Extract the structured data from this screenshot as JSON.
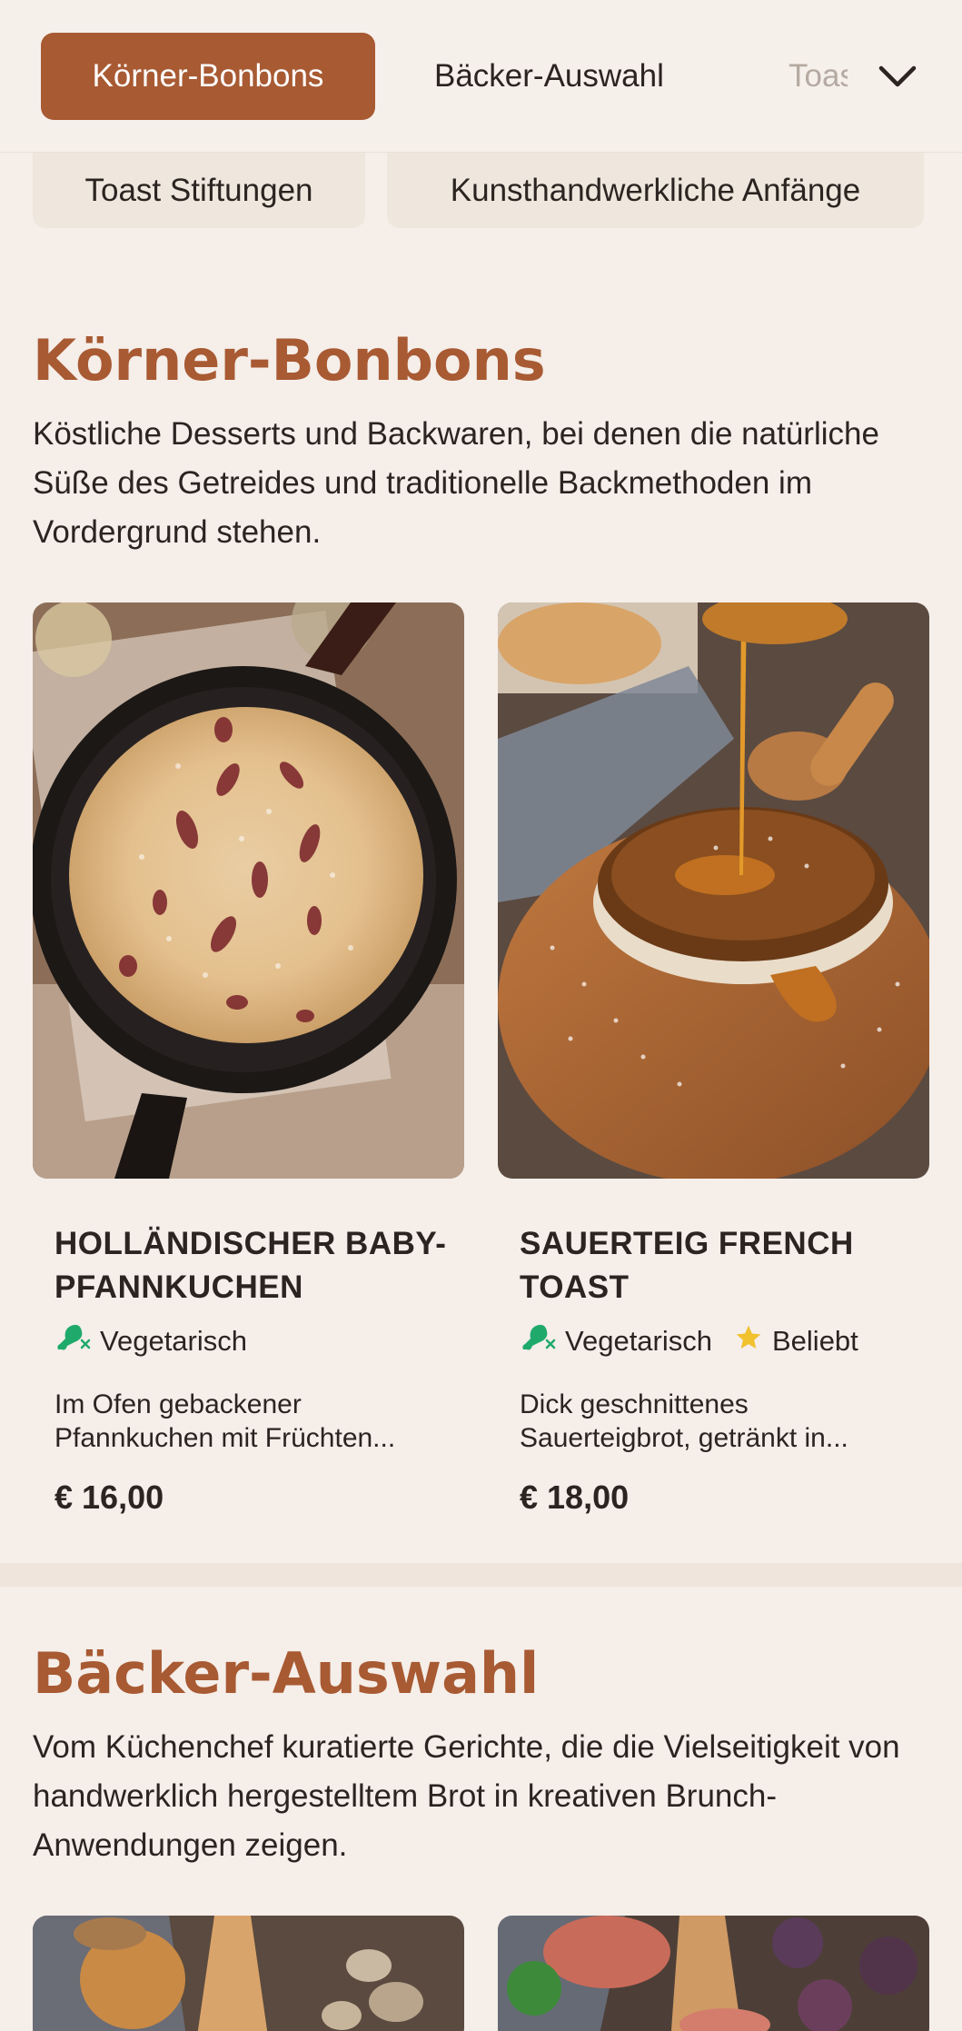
{
  "nav": {
    "tabs": [
      "Körner-Bonbons",
      "Bäcker-Auswahl",
      "Toast Stiftungen"
    ],
    "active_tab": "Körner-Bonbons",
    "chips": [
      "Toast Stiftungen",
      "Kunsthandwerkliche Anfänge"
    ]
  },
  "sections": [
    {
      "title": "Körner-Bonbons",
      "description": "Köstliche Desserts und Backwaren, bei denen die natürliche Süße des Getreides und traditionelle Backmethoden im Vordergrund stehen.",
      "items": [
        {
          "name": "HOLLÄNDISCHER BABY-PFANNKUCHEN",
          "tags": [
            "Vegetarisch"
          ],
          "description": "Im Ofen gebackener Pfannkuchen mit Früchten...",
          "price": "€ 16,00"
        },
        {
          "name": "SAUERTEIG FRENCH TOAST",
          "tags": [
            "Vegetarisch",
            "Beliebt"
          ],
          "description": "Dick geschnittenes Sauerteigbrot, getränkt in...",
          "price": "€ 18,00"
        }
      ]
    },
    {
      "title": "Bäcker-Auswahl",
      "description": "Vom Küchenchef kuratierte Gerichte, die die Vielseitigkeit von handwerklich hergestelltem Brot in kreativen Brunch-Anwendungen zeigen."
    }
  ],
  "colors": {
    "accent": "#a85a33",
    "background": "#f5eee9",
    "vegetarian_icon": "#1faa6b",
    "popular_icon": "#f2c12e"
  },
  "icons": {
    "vegetarian": "drumstick-crossed-icon",
    "popular": "star-icon",
    "dropdown": "chevron-down-icon"
  }
}
